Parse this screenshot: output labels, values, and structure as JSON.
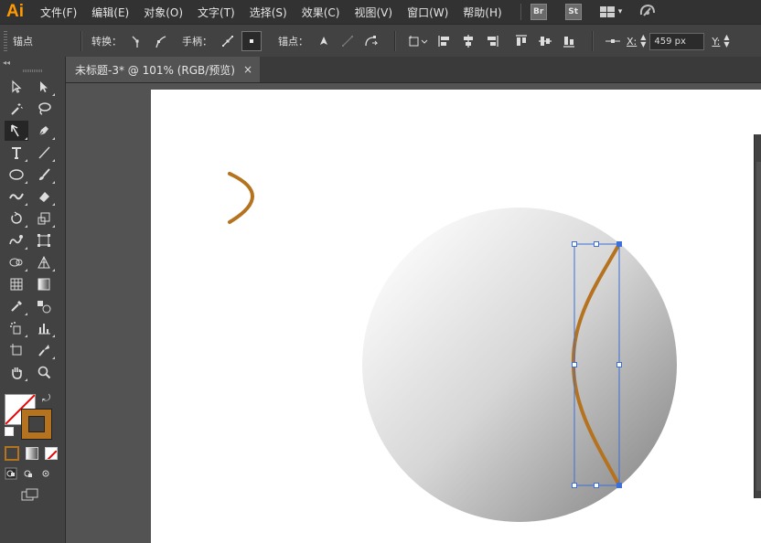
{
  "app": {
    "logo": "Ai"
  },
  "menu": [
    "文件(F)",
    "编辑(E)",
    "对象(O)",
    "文字(T)",
    "选择(S)",
    "效果(C)",
    "视图(V)",
    "窗口(W)",
    "帮助(H)"
  ],
  "app_badges": [
    "Br",
    "St"
  ],
  "tool_options": {
    "current_tool_label": "锚点",
    "convert_label": "转换：",
    "handles_label": "手柄：",
    "anchor_label": "锚点：",
    "x_label": "X:",
    "x_value": "459 px",
    "y_label": "Y:"
  },
  "document_tab": {
    "title": "未标题-3* @ 101% (RGB/预览)",
    "close_glyph": "×"
  },
  "toolbar_header": "◂◂",
  "colors": {
    "stroke_swatch": "#b5731f",
    "path_stroke": "#b5731f",
    "selection_blue": "#3d6fd6",
    "ai_orange": "#ff9a00"
  },
  "tools": [
    [
      "selection-tool-icon",
      "direct-selection-tool-icon"
    ],
    [
      "magic-wand-tool-icon",
      "lasso-tool-icon"
    ],
    [
      "anchor-point-tool-icon",
      "pen-tool-icon"
    ],
    [
      "type-tool-icon",
      "line-segment-tool-icon"
    ],
    [
      "ellipse-tool-icon",
      "paintbrush-tool-icon"
    ],
    [
      "blob-brush-tool-icon",
      "eraser-tool-icon"
    ],
    [
      "rotate-tool-icon",
      "scale-tool-icon"
    ],
    [
      "warp-tool-icon",
      "free-transform-tool-icon"
    ],
    [
      "shape-builder-tool-icon",
      "perspective-grid-tool-icon"
    ],
    [
      "mesh-tool-icon",
      "gradient-tool-icon"
    ],
    [
      "eyedropper-tool-icon",
      "blend-tool-icon"
    ],
    [
      "symbol-sprayer-tool-icon",
      "column-graph-tool-icon"
    ],
    [
      "artboard-tool-icon",
      "slice-tool-icon"
    ],
    [
      "hand-tool-icon",
      "zoom-tool-icon"
    ]
  ]
}
